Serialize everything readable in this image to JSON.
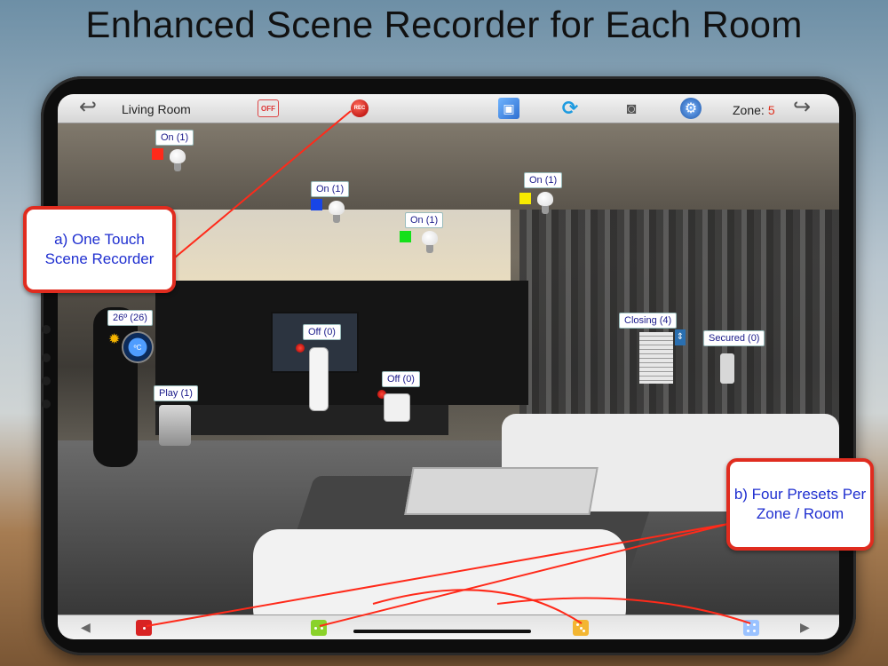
{
  "headline": "Enhanced Scene Recorder for Each Room",
  "topbar": {
    "room_name": "Living Room",
    "off_label": "OFF",
    "rec_label": "REC",
    "zone_label": "Zone:",
    "zone_number": "5",
    "icons": [
      "back-arrow-icon",
      "off-icon",
      "record-icon",
      "photo-icon",
      "refresh-icon",
      "camera-icon",
      "settings-icon",
      "forward-arrow-icon"
    ]
  },
  "devices": {
    "light1": {
      "label": "On (1)",
      "swatch": "#ff2a1a"
    },
    "light2": {
      "label": "On (1)",
      "swatch": "#1845e6"
    },
    "light3": {
      "label": "On (1)",
      "swatch": "#15e01a"
    },
    "light4": {
      "label": "On (1)",
      "swatch": "#f6ea00"
    },
    "thermostat": {
      "label": "26º (26)",
      "unit": "ºC"
    },
    "speaker": {
      "label": "Play (1)"
    },
    "tv_remote": {
      "label": "Off (0)"
    },
    "plug": {
      "label": "Off (0)"
    },
    "blinds": {
      "label": "Closing (4)"
    },
    "door_lock": {
      "label": "Secured (0)"
    }
  },
  "callouts": {
    "a": "a) One Touch Scene Recorder",
    "b": "b) Four Presets Per Zone / Room"
  },
  "presets": [
    {
      "name": "preset-1",
      "color": "#d82323",
      "dots": 1
    },
    {
      "name": "preset-2",
      "color": "#8ad22a",
      "dots": 2
    },
    {
      "name": "preset-3",
      "color": "#f3b632",
      "dots": 3
    },
    {
      "name": "preset-4",
      "color": "#9ac2ff",
      "dots": 4
    }
  ],
  "colors": {
    "callout_border": "#e02c1f",
    "callout_text": "#1f2fd0",
    "leader_line": "#ff2a1a",
    "zone_number": "#e0301e"
  }
}
